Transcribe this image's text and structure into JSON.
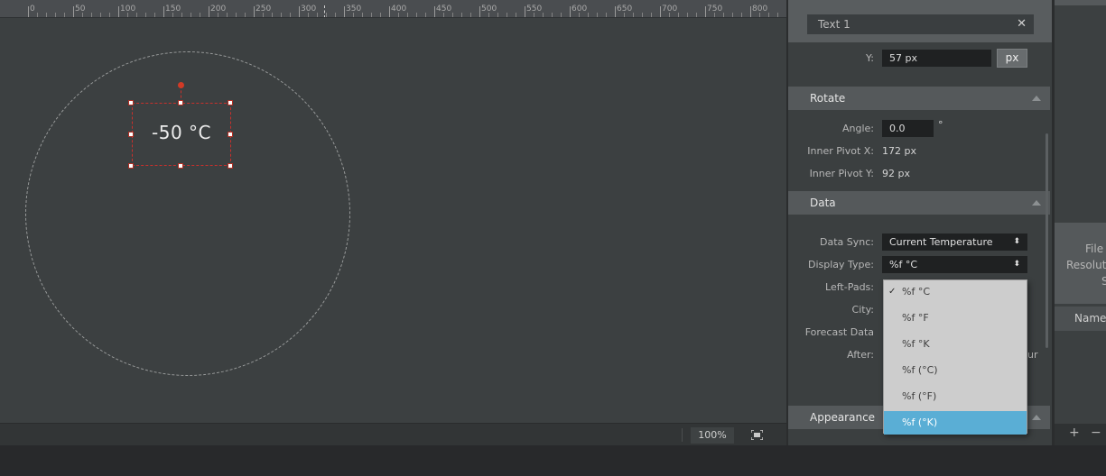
{
  "ruler": {
    "labels": [
      "0",
      "50",
      "100",
      "150",
      "200",
      "250",
      "300",
      "350",
      "400",
      "450",
      "500",
      "550",
      "600",
      "650",
      "700",
      "750",
      "800"
    ]
  },
  "canvas": {
    "text_layer_value": "-50 °C",
    "zoom_level": "100%"
  },
  "props": {
    "layer_name": "Text 1",
    "y": {
      "label": "Y:",
      "value": "57 px",
      "unit": "px"
    },
    "rotate": {
      "header": "Rotate",
      "angle_label": "Angle:",
      "angle_value": "0.0",
      "angle_unit": "°",
      "pivot_x_label": "Inner Pivot X:",
      "pivot_x_value": "172 px",
      "pivot_y_label": "Inner Pivot Y:",
      "pivot_y_value": "92 px"
    },
    "data": {
      "header": "Data",
      "data_sync_label": "Data Sync:",
      "data_sync_value": "Current Temperature",
      "display_type_label": "Display Type:",
      "display_type_value": "%f °C",
      "left_pads_label": "Left-Pads:",
      "city_label": "City:",
      "forecast_label": "Forecast Data",
      "after_label": "After:",
      "after_trailing": "ur"
    },
    "appearance": {
      "header": "Appearance"
    }
  },
  "display_type_options": [
    "%f °C",
    "%f °F",
    "%f °K",
    "%f (°C)",
    "%f (°F)",
    "%f (°K)"
  ],
  "display_type_checked": "%f °C",
  "display_type_highlighted": "%f (°K)",
  "right_panel": {
    "file_info_lines": [
      "File Na",
      "Resolut",
      "S"
    ],
    "name_header": "Name",
    "add_label": "+",
    "remove_label": "−"
  },
  "colors": {
    "accent": "#5aaed5",
    "selection": "#c8302c",
    "panel": "#3b3f40"
  }
}
